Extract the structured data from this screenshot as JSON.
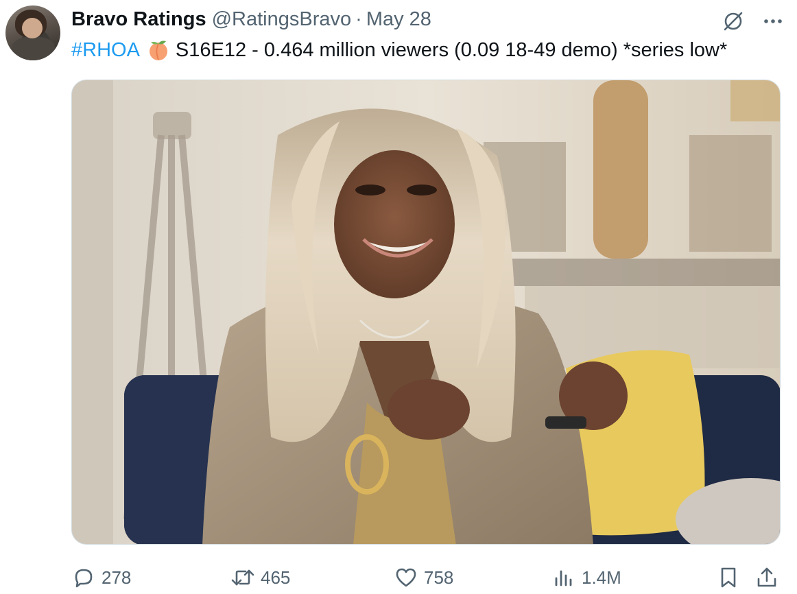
{
  "author": {
    "name": "Bravo Ratings",
    "handle": "@RatingsBravo",
    "separator": "·",
    "date": "May 28"
  },
  "tweet": {
    "hashtag": "#RHOA",
    "emoji_icon": "peach-icon",
    "text": "S16E12 - 0.464 million viewers (0.09 18-49 demo) *series low*"
  },
  "media": {
    "description_icon": "tv-still-photo"
  },
  "actions": {
    "replies": "278",
    "retweets": "465",
    "likes": "758",
    "views": "1.4M"
  },
  "colors": {
    "link": "#1d9bf0",
    "text": "#0f1419",
    "secondary": "#536471"
  }
}
